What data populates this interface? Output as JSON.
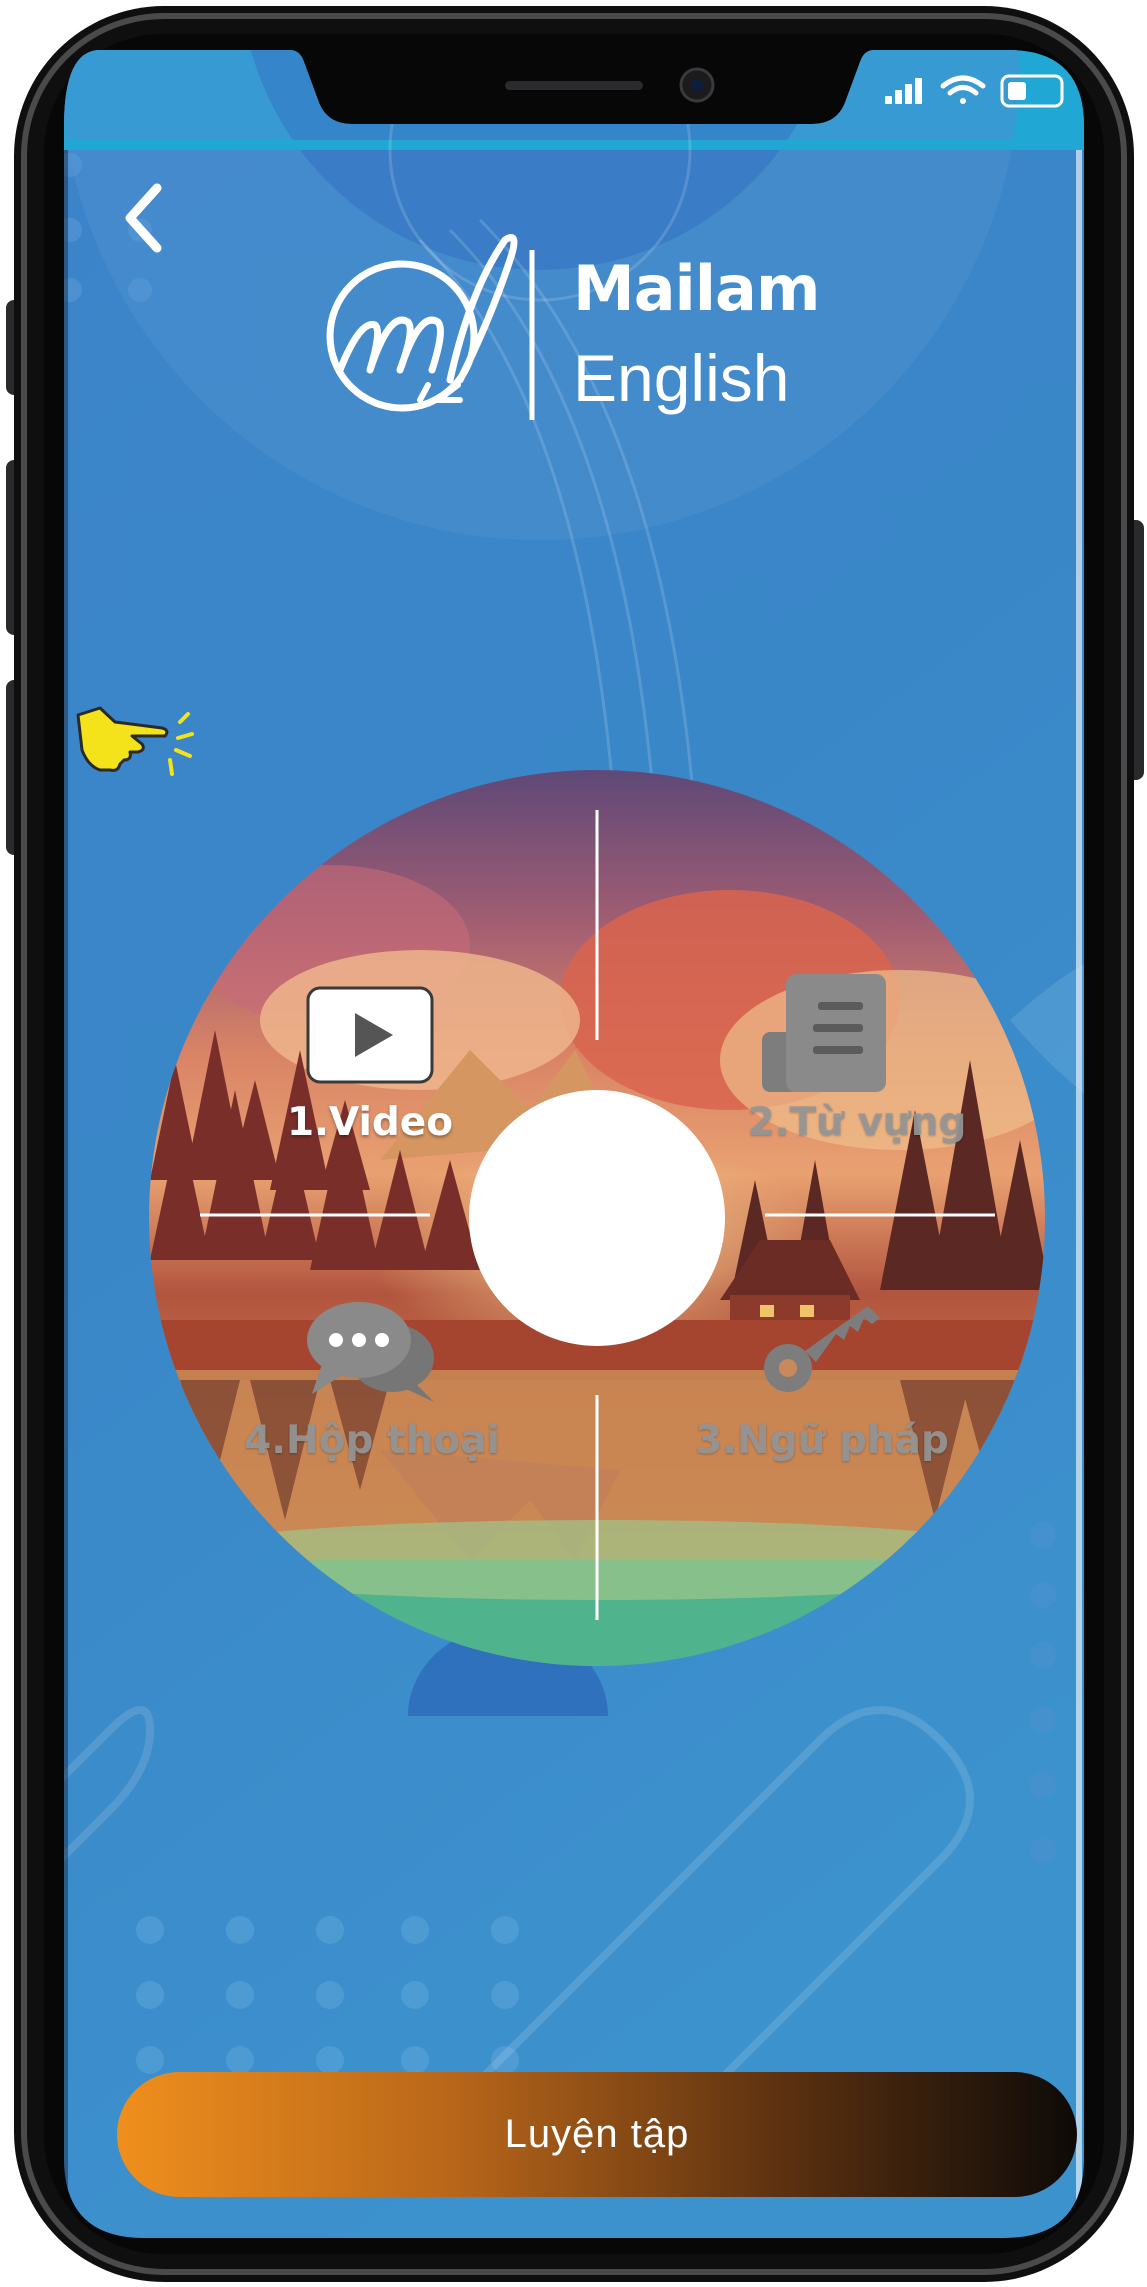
{
  "header": {
    "brand_line1": "Mailam",
    "brand_line2": "English",
    "logo_icon": "ml-signature-logo",
    "back_icon": "chevron-left-icon"
  },
  "status_bar": {
    "icons": [
      "signal-icon",
      "wifi-icon",
      "battery-icon"
    ]
  },
  "menu": {
    "items": [
      {
        "label": "1.Video",
        "icon": "play-icon",
        "state": "active"
      },
      {
        "label": "2.Từ vựng",
        "icon": "vocabulary-book-icon",
        "state": "inactive"
      },
      {
        "label": "3.Ngữ pháp",
        "icon": "key-icon",
        "state": "inactive"
      },
      {
        "label": "4.Hộp thoại",
        "icon": "chat-bubbles-icon",
        "state": "inactive"
      }
    ],
    "hint_icon": "pointing-hand-icon"
  },
  "footer": {
    "practice_label": "Luyện tập"
  },
  "colors": {
    "screen_blue": "#3a86c8",
    "status_bar": "#20a7d4",
    "practice_start": "#ef8f1c",
    "practice_end": "#0d0a08",
    "hint_yellow": "#f4e21a"
  }
}
